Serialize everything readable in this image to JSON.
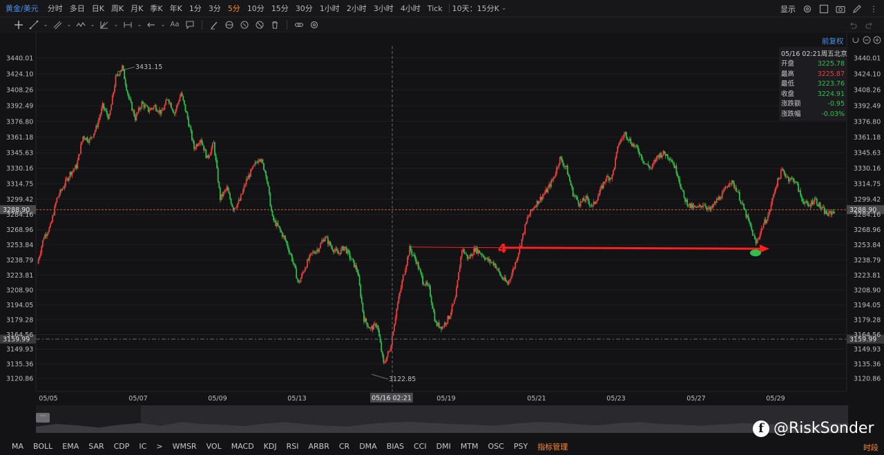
{
  "toolbar": {
    "symbol": "黄金/美元",
    "periods": [
      "分时",
      "多日",
      "日K",
      "周K",
      "月K",
      "季K",
      "年K",
      "1分",
      "3分",
      "5分",
      "10分",
      "15分",
      "30分",
      "1小时",
      "2小时",
      "3小时",
      "4小时",
      "Tick"
    ],
    "active_period": "5分",
    "range_label": "10天：15分K",
    "display_label": "显示"
  },
  "chart_header": {
    "fuquan_label": "前复权"
  },
  "info_panel": {
    "timestamp": "05/16 02:21周五北京",
    "rows": [
      {
        "label": "开盘",
        "value": "3225.78",
        "color": "#2fbf4a"
      },
      {
        "label": "最高",
        "value": "3225.87",
        "color": "#e8413d"
      },
      {
        "label": "最低",
        "value": "3223.76",
        "color": "#2fbf4a"
      },
      {
        "label": "收盘",
        "value": "3224.91",
        "color": "#2fbf4a"
      },
      {
        "label": "涨跌额",
        "value": "-0.95",
        "color": "#2fbf4a"
      },
      {
        "label": "涨跌幅",
        "value": "-0.03%",
        "color": "#2fbf4a"
      }
    ]
  },
  "chart_data": {
    "type": "line",
    "title": "",
    "y_ticks": [
      3440.01,
      3424.1,
      3408.26,
      3392.49,
      3376.8,
      3361.18,
      3345.63,
      3330.16,
      3314.75,
      3299.42,
      3284.16,
      3268.96,
      3253.84,
      3238.79,
      3223.81,
      3208.9,
      3194.05,
      3179.28,
      3164.56,
      3149.93,
      3135.36,
      3120.86
    ],
    "ylim": [
      3120.86,
      3440.01
    ],
    "x_ticks": [
      "05/05",
      "05/07",
      "05/09",
      "05/13",
      "05/19",
      "05/21",
      "05/23",
      "05/27",
      "05/29"
    ],
    "crosshair_time": "05/16 02:21",
    "current_price": 3288.9,
    "reference_price": 3159.99,
    "max_label": 3431.15,
    "min_label": 3122.85,
    "series": [
      {
        "values": [
          3235,
          3262,
          3272,
          3300,
          3312,
          3325,
          3332,
          3362,
          3358,
          3370,
          3392,
          3380,
          3420,
          3431,
          3400,
          3380,
          3395,
          3388,
          3392,
          3385,
          3400,
          3385,
          3405,
          3380,
          3350,
          3360,
          3340,
          3355,
          3300,
          3310,
          3290,
          3298,
          3318,
          3330,
          3342,
          3325,
          3280,
          3270,
          3258,
          3240,
          3215,
          3232,
          3245,
          3250,
          3262,
          3252,
          3245,
          3252,
          3240,
          3228,
          3180,
          3170,
          3175,
          3135,
          3150,
          3190,
          3222,
          3250,
          3238,
          3218,
          3210,
          3175,
          3172,
          3182,
          3200,
          3250,
          3240,
          3250,
          3245,
          3238,
          3235,
          3222,
          3215,
          3232,
          3255,
          3280,
          3292,
          3300,
          3308,
          3320,
          3340,
          3330,
          3305,
          3295,
          3300,
          3292,
          3305,
          3320,
          3322,
          3355,
          3365,
          3355,
          3348,
          3335,
          3330,
          3343,
          3345,
          3340,
          3325,
          3300,
          3292,
          3290,
          3295,
          3288,
          3298,
          3305,
          3318,
          3310,
          3292,
          3275,
          3255,
          3272,
          3285,
          3312,
          3328,
          3320,
          3318,
          3300,
          3292,
          3300,
          3290,
          3284,
          3288
        ]
      }
    ],
    "annotation": {
      "type": "arrow",
      "label": "4",
      "from_price": 3251,
      "to_price": 3250,
      "color": "#ff2020"
    },
    "navigator_volume": [
      0.35,
      0.5,
      0.42,
      0.3,
      0.45,
      0.55,
      0.4,
      0.6,
      0.5,
      0.45,
      0.38,
      0.52,
      0.6,
      0.48,
      0.4,
      0.35,
      0.5,
      0.58,
      0.62,
      0.55,
      0.5,
      0.45,
      0.4,
      0.52,
      0.6,
      0.58,
      0.48,
      0.42,
      0.55,
      0.6,
      0.5,
      0.45,
      0.4,
      0.48,
      0.55,
      0.5,
      0.45,
      0.42,
      0.5,
      0.55
    ]
  },
  "indicators": [
    "MA",
    "BOLL",
    "EMA",
    "SAR",
    "CDP",
    "IC",
    ">",
    "WMSR",
    "VOL",
    "MACD",
    "KDJ",
    "RSI",
    "ARBR",
    "CR",
    "DMA",
    "BIAS",
    "CCI",
    "DMI",
    "MTM",
    "OSC",
    "PSY"
  ],
  "indicator_manage_label": "指标管理",
  "time_segment_label": "时段",
  "watermark": {
    "logo": "f",
    "handle": "@RiskSonder"
  },
  "navigator_handle": "···",
  "colors": {
    "up": "#e8413d",
    "down": "#2fbf4a",
    "accent": "#ff8a1f",
    "link": "#4a8fe7",
    "current_line": "#c0623a"
  }
}
